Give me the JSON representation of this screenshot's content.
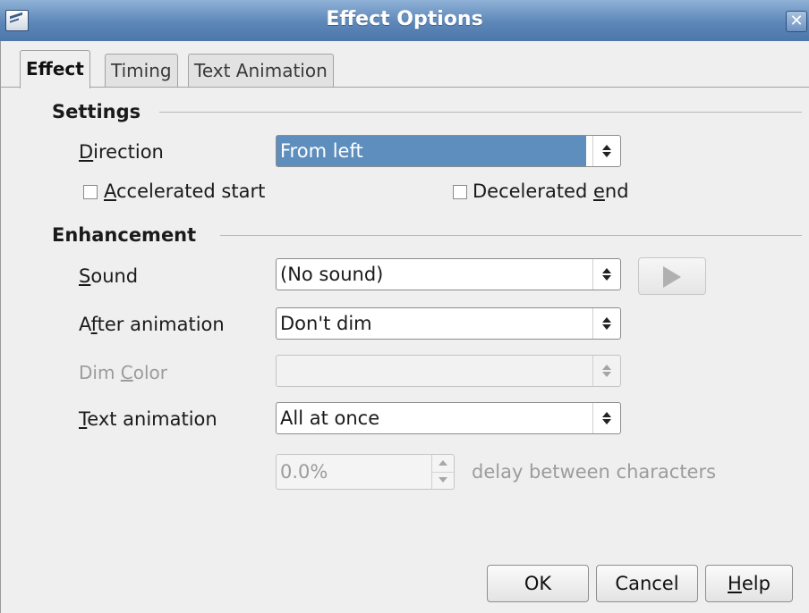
{
  "window": {
    "title": "Effect Options",
    "close_glyph": "✕",
    "app_icon": "document-app-icon"
  },
  "tabs": [
    {
      "label": "Effect",
      "active": true
    },
    {
      "label": "Timing",
      "active": false
    },
    {
      "label": "Text Animation",
      "active": false
    }
  ],
  "settings": {
    "heading": "Settings",
    "direction": {
      "label_underlined": "D",
      "label_rest": "irection",
      "value": "From left"
    },
    "accelerated": {
      "label_underlined": "A",
      "label_rest": "ccelerated start",
      "checked": false
    },
    "decelerated": {
      "label_before": "Decelerated ",
      "label_underlined": "e",
      "label_after": "nd",
      "checked": false
    }
  },
  "enhancement": {
    "heading": "Enhancement",
    "sound": {
      "label_underlined": "S",
      "label_rest": "ound",
      "value": "(No sound)",
      "play_icon": "play-icon"
    },
    "after_animation": {
      "label_before": "A",
      "label_underlined": "f",
      "label_after": "ter animation",
      "value": "Don't dim"
    },
    "dim_color": {
      "label_before": "Dim ",
      "label_underlined": "C",
      "label_after": "olor",
      "value": "",
      "enabled": false
    },
    "text_animation": {
      "label_underlined": "T",
      "label_rest": "ext animation",
      "value": "All at once"
    },
    "delay": {
      "value": "0.0%",
      "suffix": "delay between characters",
      "enabled": false
    }
  },
  "buttons": {
    "ok": "OK",
    "cancel": "Cancel",
    "help_underlined": "H",
    "help_rest": "elp"
  },
  "colors": {
    "titlebar": "#5d87b8",
    "selection": "#5e8ebd",
    "disabled_text": "#9c9c9c"
  }
}
